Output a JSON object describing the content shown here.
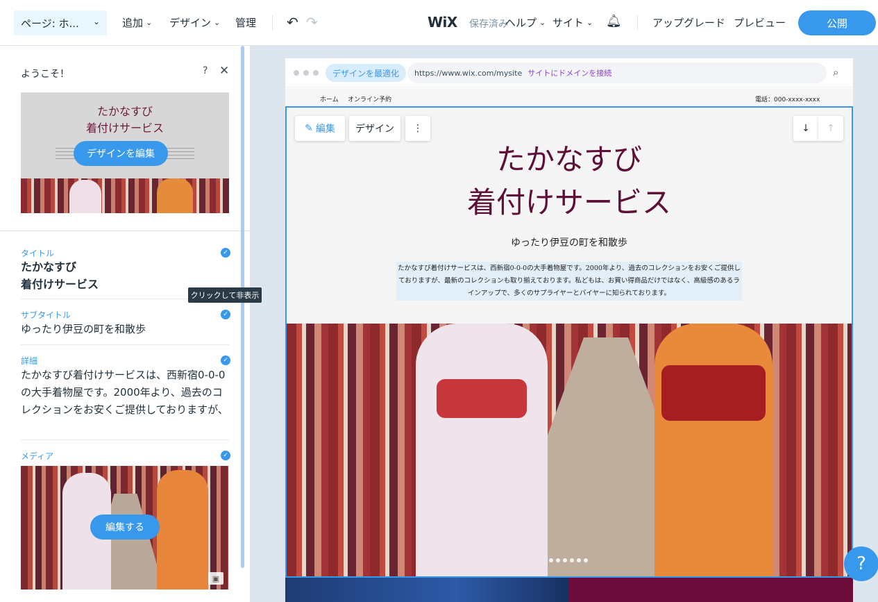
{
  "topbar": {
    "page_select": "ページ: ホ...",
    "menus": [
      {
        "label": "追加"
      },
      {
        "label": "デザイン"
      },
      {
        "label": "管理"
      }
    ],
    "logo": "WiX",
    "save_status": "保存済み",
    "help": "ヘルプ",
    "site": "サイト",
    "upgrade": "アップグレード",
    "preview": "プレビュー",
    "publish": "公開"
  },
  "panel": {
    "title": "ようこそ！",
    "help_icon": "?",
    "close_icon": "✕",
    "preview_title": "たかなすび\n着付けサービス",
    "edit_design": "デザインを編集",
    "fields": {
      "title_label": "タイトル",
      "title_value": "たかなすび\n着付けサービス",
      "subtitle_label": "サブタイトル",
      "subtitle_value": "ゆったり伊豆の町を和散歩",
      "detail_label": "詳細",
      "detail_value": "たかなすび着付けサービスは、西新宿0-0-0の大手着物屋です。2000年より、過去のコレクションをお安くご提供しておりますが、最新のコレクションも取り揃えております。私ども",
      "media_label": "メディア",
      "media_edit": "編集する"
    },
    "tooltip": "クリックして非表示"
  },
  "browser": {
    "optimize": "デザインを最適化",
    "url": "https://www.wix.com/mysite",
    "connect_domain": "サイトにドメインを接続",
    "nav": {
      "home": "ホーム",
      "booking": "オンライン予約",
      "phone": "電話：000-xxxx-xxxx"
    }
  },
  "section": {
    "edit": "編集",
    "design": "デザイン",
    "more": "⋮",
    "down": "↓",
    "up": "↑",
    "title": "たかなすび\n着付けサービス",
    "subtitle": "ゆったり伊豆の町を和散歩",
    "description": "たかなすび着付けサービスは、西新宿0-0-0の大手着物屋です。2000年より、過去のコレクションをお安くご提供しておりますが、最新のコレクションも取り揃えております。私どもは、お買い得商品だけではなく、高級感のあるラインアップで、多くのサプライヤーとバイヤーに知られております。"
  },
  "help_bubble": "?",
  "colors": {
    "accent": "#3899ec",
    "title_color": "#5e0f37",
    "connect_color": "#8f3fd3"
  },
  "icons": {
    "undo": "undo-icon",
    "redo": "redo-icon",
    "bell": "bell-icon",
    "zoom": "zoom-icon",
    "pencil": "pencil-icon",
    "media": "media-icon"
  }
}
